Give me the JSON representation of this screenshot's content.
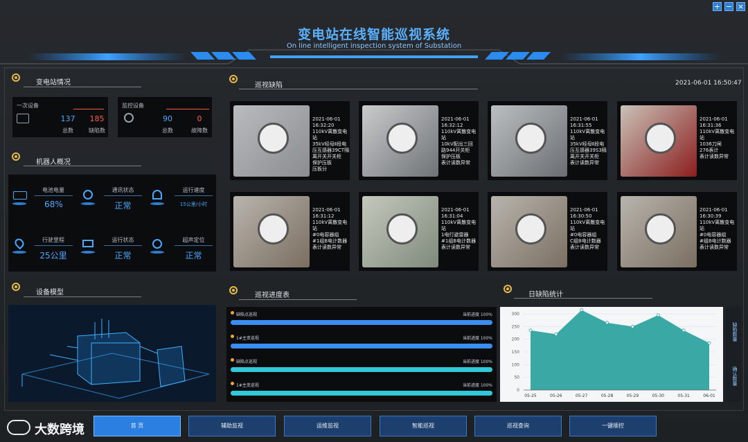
{
  "window": {
    "controls": [
      "+",
      "−",
      "×"
    ]
  },
  "header": {
    "title": "变电站在线智能巡视系统",
    "subtitle": "On line intelligent inspection system of Substation"
  },
  "station": {
    "heading": "变电站情况",
    "primary": {
      "label": "一次设备",
      "total": "137",
      "defects": "185",
      "total_label": "总数",
      "defect_label": "缺陷数"
    },
    "monitor": {
      "label": "监控设备",
      "total": "90",
      "faults": "0",
      "total_label": "总数",
      "fault_label": "故障数"
    }
  },
  "robot": {
    "heading": "机器人概况",
    "items": [
      {
        "label": "电池电量",
        "value": "68%",
        "icon": "battery-icon"
      },
      {
        "label": "通讯状态",
        "value": "正常",
        "icon": "signal-icon"
      },
      {
        "label": "运行速度",
        "value": "15公里/小时",
        "icon": "speedometer-icon"
      },
      {
        "label": "行驶里程",
        "value": "25公里",
        "icon": "location-icon"
      },
      {
        "label": "运行状态",
        "value": "正常",
        "icon": "monitor-icon"
      },
      {
        "label": "超声定位",
        "value": "正常",
        "icon": "radar-icon"
      }
    ]
  },
  "model": {
    "heading": "设备模型"
  },
  "inspection": {
    "heading": "巡视缺陷",
    "datetime": "2021-06-01 16:50:47",
    "items": [
      {
        "caption": "2021-06-01\n16:32:20\n110kV离散变电\n站\n35kV经母Ⅱ段电\n压互感器39CT隔\n离开关开关柜\n保护压板\n压板分"
      },
      {
        "caption": "2021-06-01\n16:32:12\n110kV离散变电\n站\n10kV配出三回\n路944开关柜\n保护压板\n表计读数异常"
      },
      {
        "caption": "2021-06-01\n16:31:55\n110kV离散变电\n站\n35kV经母Ⅱ段电\n压互感器39S3隔\n离开关开关柜\n表计读数异常"
      },
      {
        "caption": "2021-06-01\n16:31:36\n110kV离散变电\n站\n1036刀闸\n276表计\n表计读数异常"
      },
      {
        "caption": "2021-06-01\n16:31:12\n110kV离散变电\n站\n#0电容器组\n#1组B电计数器\n表计读数异常"
      },
      {
        "caption": "2021-06-01\n16:31:04\n110kV离散变电\n站\n1电行避雷器\n#1组B电计数器\n表计读数异常"
      },
      {
        "caption": "2021-06-01\n16:30:50\n110kV离散变电\n站\n#0电容器组\nC组B电计数器\n表计读数异常"
      },
      {
        "caption": "2021-06-01\n16:30:39\n110kV离散变电\n站\n#0电容器组\n#组B电计数器\n表计读数异常"
      }
    ]
  },
  "progress": {
    "heading": "巡视进度表",
    "rows": [
      {
        "name": "缺陷点巡视",
        "status": "当前进度 100%",
        "value": 100,
        "color": "#3a8ef0"
      },
      {
        "name": "1#主变巡视",
        "status": "当前进度 100%",
        "value": 100,
        "color": "#3a8ef0"
      },
      {
        "name": "缺陷点巡视",
        "status": "当前进度 100%",
        "value": 100,
        "color": "#31c8d8"
      },
      {
        "name": "1#主变巡视",
        "status": "当前进度 100%",
        "value": 100,
        "color": "#31c8d8"
      }
    ]
  },
  "daily": {
    "heading": "日缺陷统计",
    "side_buttons": [
      "缺陷数量",
      "确认数量"
    ]
  },
  "chart_data": {
    "type": "area",
    "categories": [
      "05-25",
      "05-26",
      "05-27",
      "05-28",
      "05-29",
      "05-30",
      "05-31",
      "06-01"
    ],
    "values": [
      235,
      220,
      315,
      265,
      250,
      295,
      235,
      185
    ],
    "ylim": [
      0,
      300
    ],
    "yticks": [
      0,
      50,
      100,
      150,
      200,
      250,
      300
    ],
    "color": "#2fa3a0"
  },
  "nav": {
    "items": [
      "首 页",
      "辅助监视",
      "运维监视",
      "智能巡视",
      "巡视查询",
      "一键顺控"
    ],
    "active": 0
  },
  "watermark": {
    "text": "大数跨境"
  }
}
